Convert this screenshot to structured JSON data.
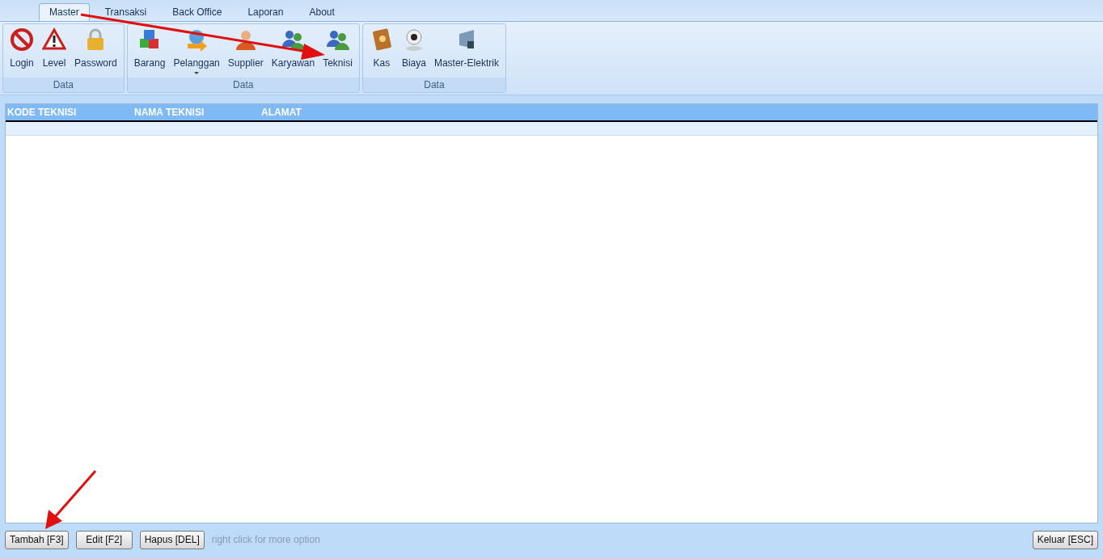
{
  "tabs": [
    {
      "label": "Master",
      "selected": true
    },
    {
      "label": "Transaksi",
      "selected": false
    },
    {
      "label": "Back Office",
      "selected": false
    },
    {
      "label": "Laporan",
      "selected": false
    },
    {
      "label": "About",
      "selected": false
    }
  ],
  "ribbon_groups": [
    {
      "label": "Data",
      "items": [
        {
          "label": "Login",
          "kind": "no-entry"
        },
        {
          "label": "Level",
          "kind": "warning"
        },
        {
          "label": "Password",
          "kind": "padlock"
        }
      ]
    },
    {
      "label": "Data",
      "items": [
        {
          "label": "Barang",
          "kind": "cubes"
        },
        {
          "label": "Pelanggan",
          "kind": "globe",
          "has_menu": true
        },
        {
          "label": "Supplier",
          "kind": "person"
        },
        {
          "label": "Karyawan",
          "kind": "people"
        },
        {
          "label": "Teknisi",
          "kind": "people"
        }
      ]
    },
    {
      "label": "Data",
      "items": [
        {
          "label": "Kas",
          "kind": "book"
        },
        {
          "label": "Biaya",
          "kind": "webcam"
        },
        {
          "label": "Master-Elektrik",
          "kind": "window"
        }
      ]
    }
  ],
  "table": {
    "columns": [
      "KODE TEKNISI",
      "NAMA TEKNISI",
      "ALAMAT"
    ]
  },
  "buttons": [
    "Tambah [F3]",
    "Edit [F2]",
    "Hapus [DEL]"
  ],
  "hint": "right click for more option",
  "exit_button": "Keluar [ESC]"
}
